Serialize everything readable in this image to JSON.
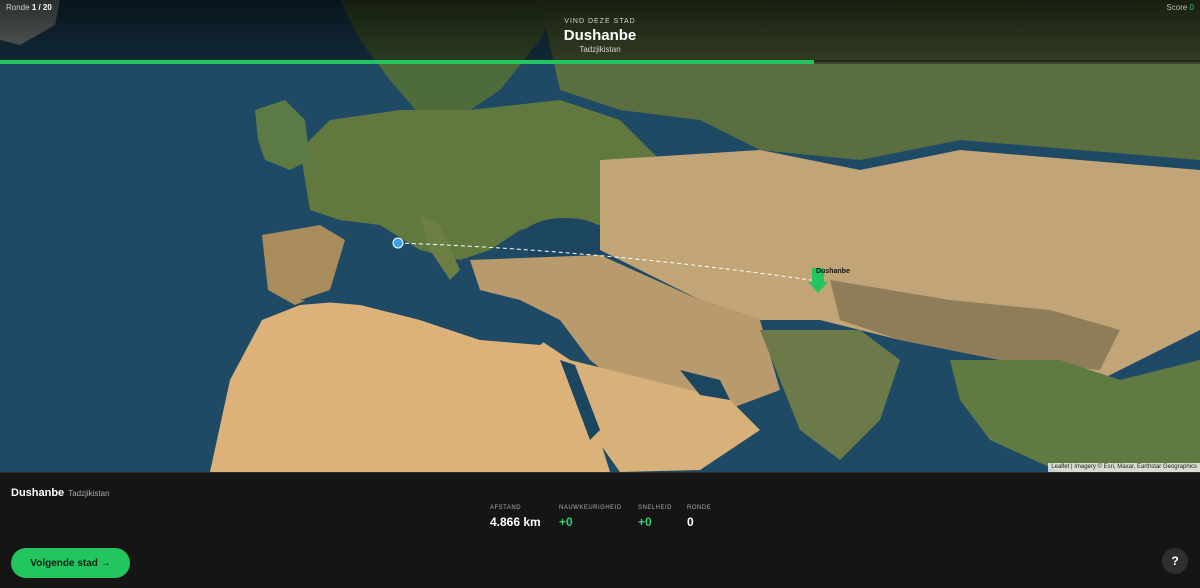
{
  "header": {
    "round_label": "Ronde",
    "round_value": "1 / 20",
    "score_label": "Score",
    "score_value": "0",
    "prompt_label": "VIND DEZE STAD",
    "target_city": "Dushanbe",
    "target_country": "Tadzjikistan",
    "progress_fraction": 0.678
  },
  "map": {
    "marker_label": "Dushanbe",
    "attribution": "Leaflet | Imagery © Esri, Maxar, Earthstar Geographics"
  },
  "result": {
    "city": "Dushanbe",
    "country": "Tadzjikistan",
    "stats": [
      {
        "label": "AFSTAND",
        "value": "4.866 km",
        "green": false
      },
      {
        "label": "NAUWKEURIGHEID",
        "value": "+0",
        "green": true
      },
      {
        "label": "SNELHEID",
        "value": "+0",
        "green": true
      },
      {
        "label": "RONDE",
        "value": "0",
        "green": false
      }
    ]
  },
  "buttons": {
    "next_label": "Volgende stad →",
    "help_label": "?"
  },
  "colors": {
    "accent": "#22c55e",
    "guess_marker": "#3aa0e8"
  }
}
